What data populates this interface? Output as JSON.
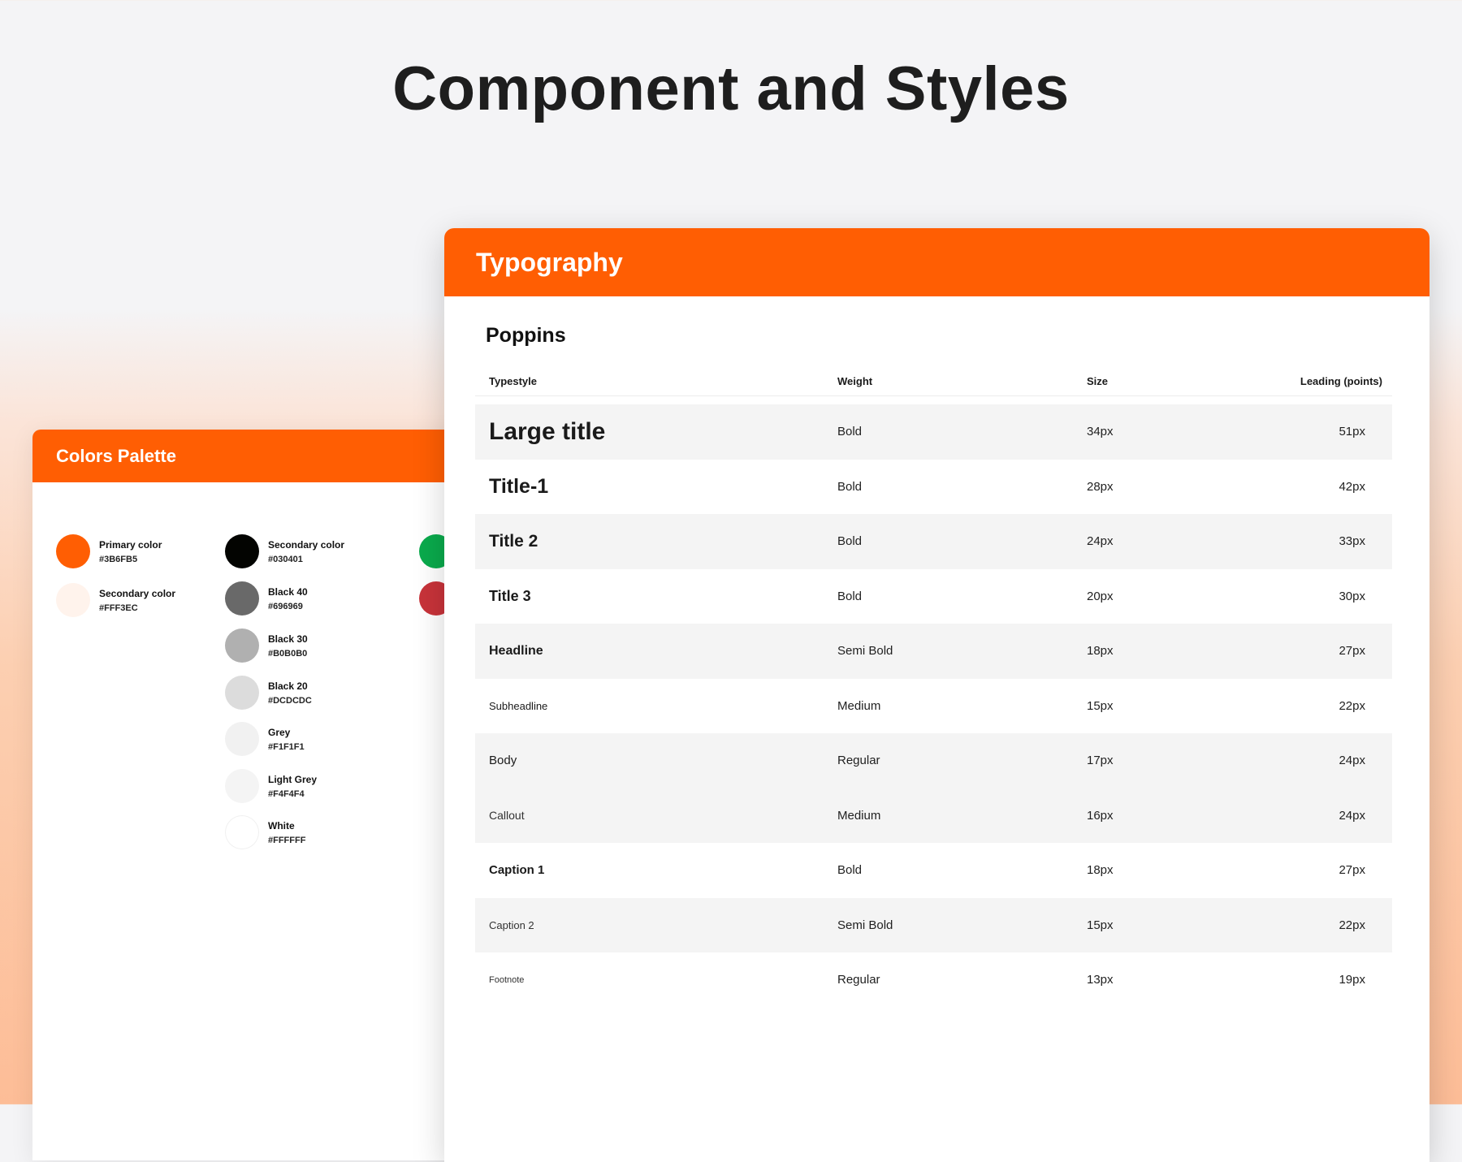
{
  "page_title": "Component and Styles",
  "colors_palette": {
    "title": "Colors Palette",
    "swatches": [
      {
        "name": "Primary color",
        "hex": "#3B6FB5",
        "color": "#ff5e03"
      },
      {
        "name": "Secondary color",
        "hex": "#FFF3EC",
        "color": "#fff3ec"
      },
      {
        "name": "Secondary color",
        "hex": "#030401",
        "color": "#030401"
      },
      {
        "name": "Black 40",
        "hex": "#696969",
        "color": "#696969"
      },
      {
        "name": "Black 30",
        "hex": "#B0B0B0",
        "color": "#b0b0b0"
      },
      {
        "name": "Black 20",
        "hex": "#DCDCDC",
        "color": "#dcdcdc"
      },
      {
        "name": "Grey",
        "hex": "#F1F1F1",
        "color": "#f1f1f1"
      },
      {
        "name": "Light Grey",
        "hex": "#F4F4F4",
        "color": "#f4f4f4"
      },
      {
        "name": "White",
        "hex": "#FFFFFF",
        "color": "#ffffff"
      }
    ],
    "partial_swatches": [
      {
        "color": "#0aaa4c"
      },
      {
        "color": "#c8333a"
      }
    ]
  },
  "typography": {
    "title": "Typography",
    "font_name": "Poppins",
    "columns": [
      "Typestyle",
      "Weight",
      "Size",
      "Leading (points)"
    ],
    "rows": [
      {
        "style": "Large title",
        "weight": "Bold",
        "size": "34px",
        "leading": "51px"
      },
      {
        "style": "Title-1",
        "weight": "Bold",
        "size": "28px",
        "leading": "42px"
      },
      {
        "style": "Title 2",
        "weight": "Bold",
        "size": "24px",
        "leading": "33px"
      },
      {
        "style": "Title 3",
        "weight": "Bold",
        "size": "20px",
        "leading": "30px"
      },
      {
        "style": "Headline",
        "weight": "Semi Bold",
        "size": "18px",
        "leading": "27px"
      },
      {
        "style": "Subheadline",
        "weight": "Medium",
        "size": "15px",
        "leading": "22px"
      },
      {
        "style": "Body",
        "weight": "Regular",
        "size": "17px",
        "leading": "24px"
      },
      {
        "style": "Callout",
        "weight": "Medium",
        "size": "16px",
        "leading": "24px"
      },
      {
        "style": "Caption 1",
        "weight": "Bold",
        "size": "18px",
        "leading": "27px"
      },
      {
        "style": "Caption 2",
        "weight": "Semi Bold",
        "size": "15px",
        "leading": "22px"
      },
      {
        "style": "Footnote",
        "weight": "Regular",
        "size": "13px",
        "leading": "19px"
      }
    ]
  }
}
